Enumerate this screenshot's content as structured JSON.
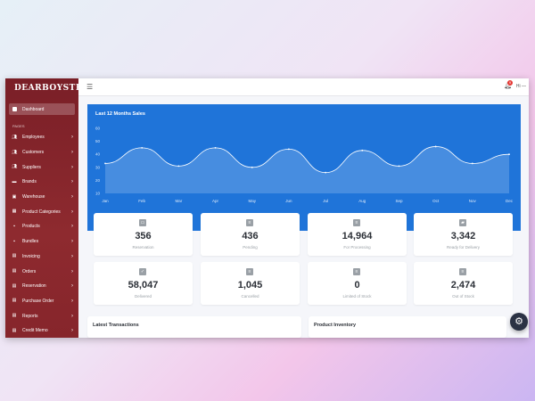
{
  "sidebar": {
    "logo_text": "DEARBOYSTER",
    "active_item": "Dashboard",
    "section_label": "PAGES",
    "items": [
      {
        "label": "Employees",
        "icon": "users-icon"
      },
      {
        "label": "Customers",
        "icon": "users-icon"
      },
      {
        "label": "Suppliers",
        "icon": "users-icon"
      },
      {
        "label": "Brands",
        "icon": "tag-icon"
      },
      {
        "label": "Warehouse",
        "icon": "warehouse-icon"
      },
      {
        "label": "Product Categories",
        "icon": "grid-icon"
      },
      {
        "label": "Products",
        "icon": "box-icon"
      },
      {
        "label": "Bundles",
        "icon": "box-icon"
      },
      {
        "label": "Invoicing",
        "icon": "document-icon"
      },
      {
        "label": "Orders",
        "icon": "document-icon"
      },
      {
        "label": "Reservation",
        "icon": "document-icon"
      },
      {
        "label": "Purchase Order",
        "icon": "document-icon"
      },
      {
        "label": "Reports",
        "icon": "document-icon"
      },
      {
        "label": "Credit  Memo",
        "icon": "document-icon"
      }
    ]
  },
  "topbar": {
    "notification_count": "9",
    "user_label": "Hi —"
  },
  "chart_data": {
    "type": "area",
    "title": "Last 12 Months Sales",
    "categories": [
      "Jan",
      "Feb",
      "Mar",
      "Apr",
      "May",
      "Jun",
      "Jul",
      "Aug",
      "Sep",
      "Oct",
      "Nov",
      "Dec"
    ],
    "values": [
      33,
      45,
      31,
      45,
      30,
      44,
      26,
      43,
      31,
      46,
      33,
      40
    ],
    "ylim": [
      10,
      60
    ],
    "yticks": [
      10,
      20,
      30,
      40,
      50,
      60
    ],
    "grid": false,
    "colors": {
      "background": "#1f74d9",
      "line": "#ffffff"
    }
  },
  "stats": [
    {
      "value": "356",
      "label": "Reservation",
      "icon": "briefcase-icon"
    },
    {
      "value": "436",
      "label": "Pending",
      "icon": "clipboard-icon"
    },
    {
      "value": "14,964",
      "label": "For Processing",
      "icon": "clipboard-icon"
    },
    {
      "value": "3,342",
      "label": "Ready for Delivery",
      "icon": "truck-icon"
    },
    {
      "value": "58,047",
      "label": "Delivered",
      "icon": "check-square-icon"
    },
    {
      "value": "1,045",
      "label": "Cancelled",
      "icon": "clipboard-icon"
    },
    {
      "value": "0",
      "label": "Limited of Stock",
      "icon": "clipboard-icon"
    },
    {
      "value": "2,474",
      "label": "Out of Stock",
      "icon": "clipboard-icon"
    }
  ],
  "panels": {
    "transactions_title": "Latest Transactions",
    "inventory_title": "Product Inventory"
  },
  "colors": {
    "sidebar": "#8e2a2f",
    "accent": "#1f74d9",
    "fab": "#2b3244"
  }
}
